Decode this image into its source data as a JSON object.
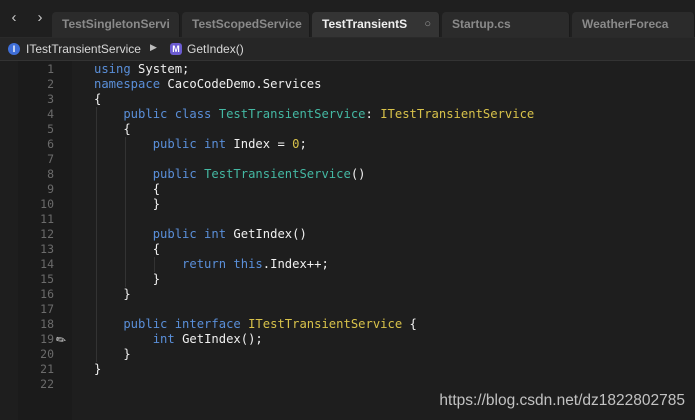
{
  "tabs": [
    {
      "label": "TestSingletonServi",
      "active": false
    },
    {
      "label": "TestScopedService",
      "active": false
    },
    {
      "label": "TestTransientS",
      "active": true
    },
    {
      "label": "Startup.cs",
      "active": false
    },
    {
      "label": "WeatherForeca",
      "active": false
    }
  ],
  "tab_close_glyph": "○",
  "breadcrumb": {
    "interface_label": "ITestTransientService",
    "interface_icon": "I",
    "method_label": "GetIndex()",
    "method_icon": "M",
    "separator": "▶"
  },
  "nav": {
    "back": "‹",
    "forward": "›"
  },
  "line_numbers": [
    "1",
    "2",
    "3",
    "4",
    "5",
    "6",
    "7",
    "8",
    "9",
    "10",
    "11",
    "12",
    "13",
    "14",
    "15",
    "16",
    "17",
    "18",
    "19",
    "20",
    "21",
    "22"
  ],
  "code": [
    [
      {
        "t": "using ",
        "c": "kw"
      },
      {
        "t": "System;",
        "c": ""
      }
    ],
    [
      {
        "t": "namespace ",
        "c": "kw"
      },
      {
        "t": "CacoCodeDemo.Services",
        "c": ""
      }
    ],
    [
      {
        "t": "{",
        "c": ""
      }
    ],
    [
      {
        "t": "    public class ",
        "c": "kw"
      },
      {
        "t": "TestTransientService",
        "c": "ty"
      },
      {
        "t": ": ",
        "c": ""
      },
      {
        "t": "ITestTransientService",
        "c": "it"
      }
    ],
    [
      {
        "t": "    {",
        "c": ""
      }
    ],
    [
      {
        "t": "        public int ",
        "c": "kw"
      },
      {
        "t": "Index = ",
        "c": ""
      },
      {
        "t": "0",
        "c": "nm"
      },
      {
        "t": ";",
        "c": ""
      }
    ],
    [],
    [
      {
        "t": "        public ",
        "c": "kw"
      },
      {
        "t": "TestTransientService",
        "c": "ty"
      },
      {
        "t": "()",
        "c": ""
      }
    ],
    [
      {
        "t": "        {",
        "c": ""
      }
    ],
    [
      {
        "t": "        }",
        "c": ""
      }
    ],
    [],
    [
      {
        "t": "        public int ",
        "c": "kw"
      },
      {
        "t": "GetIndex()",
        "c": ""
      }
    ],
    [
      {
        "t": "        {",
        "c": ""
      }
    ],
    [
      {
        "t": "            return ",
        "c": "kw"
      },
      {
        "t": "this",
        "c": "kw"
      },
      {
        "t": ".Index++;",
        "c": ""
      }
    ],
    [
      {
        "t": "        }",
        "c": ""
      }
    ],
    [
      {
        "t": "    }",
        "c": ""
      }
    ],
    [],
    [
      {
        "t": "    public interface ",
        "c": "kw"
      },
      {
        "t": "ITestTransientService",
        "c": "it"
      },
      {
        "t": " {",
        "c": ""
      }
    ],
    [
      {
        "t": "        int ",
        "c": "kw"
      },
      {
        "t": "GetIndex();",
        "c": ""
      }
    ],
    [
      {
        "t": "    }",
        "c": ""
      }
    ],
    [
      {
        "t": "}",
        "c": ""
      }
    ],
    []
  ],
  "watermark": "https://blog.csdn.net/dz1822802785"
}
